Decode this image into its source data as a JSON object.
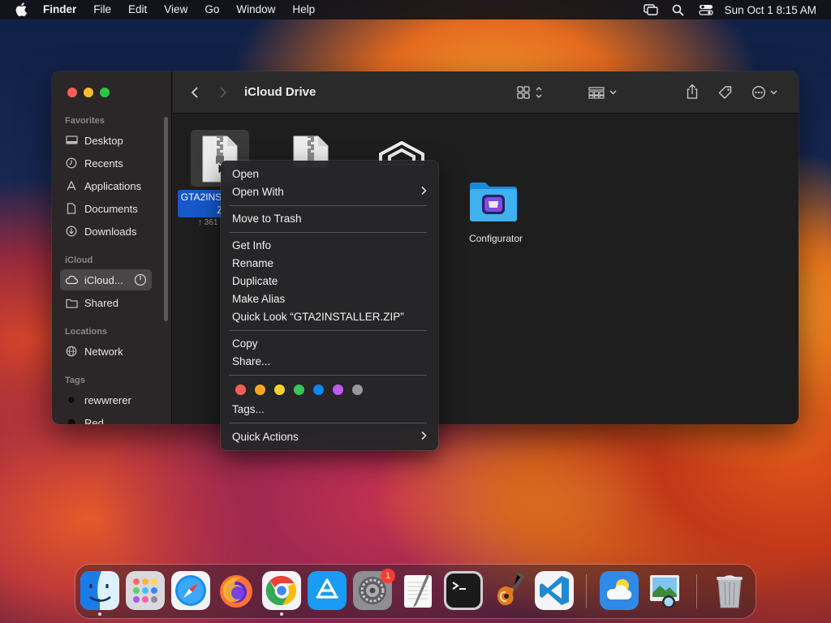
{
  "menubar": {
    "app_name": "Finder",
    "menus": [
      "File",
      "Edit",
      "View",
      "Go",
      "Window",
      "Help"
    ],
    "clock": "Sun Oct 1  8:15 AM",
    "icons": [
      "apple-icon",
      "screen-mirroring-icon",
      "spotlight-icon",
      "control-center-icon"
    ]
  },
  "window": {
    "title": "iCloud Drive",
    "sidebar": {
      "sections": [
        {
          "heading": "Favorites",
          "items": [
            "Desktop",
            "Recents",
            "Applications",
            "Documents",
            "Downloads"
          ]
        },
        {
          "heading": "iCloud",
          "items": [
            "iCloud...",
            "Shared"
          ]
        },
        {
          "heading": "Locations",
          "items": [
            "Network"
          ]
        },
        {
          "heading": "Tags",
          "items": [
            "rewwrerer",
            "Red"
          ]
        }
      ],
      "selected": "iCloud..."
    },
    "files": [
      {
        "name_line1": "GTA2INS",
        "name_line2": "Z",
        "meta": "↑ 361",
        "selected": true,
        "kind": "zip"
      },
      {
        "name": "",
        "kind": "zip"
      },
      {
        "name": "",
        "kind": "app"
      },
      {
        "name": "Configurator",
        "kind": "folder"
      }
    ]
  },
  "context_menu": {
    "open": "Open",
    "open_with": "Open With",
    "move_to_trash": "Move to Trash",
    "get_info": "Get Info",
    "rename": "Rename",
    "duplicate": "Duplicate",
    "make_alias": "Make Alias",
    "quick_look": "Quick Look “GTA2INSTALLER.ZIP”",
    "copy": "Copy",
    "share": "Share...",
    "tags": "Tags...",
    "quick_actions": "Quick Actions",
    "tag_colors": [
      "#ff5f57",
      "#f5a623",
      "#f8d12f",
      "#34c759",
      "#0a84ff",
      "#bf5af2",
      "#98989d"
    ]
  },
  "dock": {
    "apps": [
      "Finder",
      "Launchpad",
      "Safari",
      "Firefox",
      "Google Chrome",
      "App Store",
      "System Settings",
      "TextEdit",
      "Terminal",
      "GarageBand",
      "Visual Studio Code",
      "Weather",
      "Preview",
      "Trash"
    ],
    "system_settings_badge": "1"
  }
}
